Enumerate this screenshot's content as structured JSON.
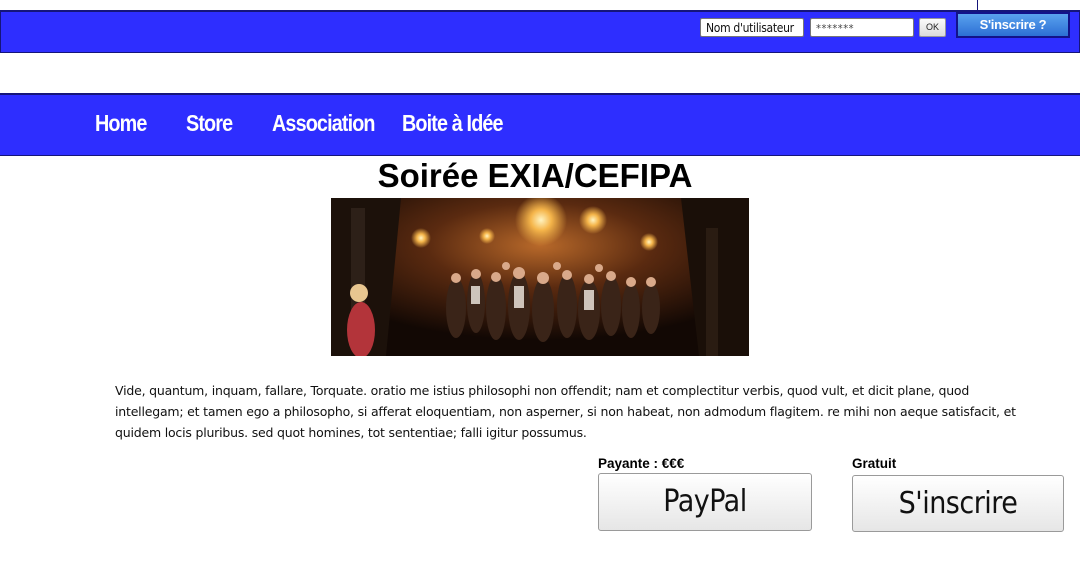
{
  "header": {
    "username_placeholder": "Nom d'utilisateur",
    "password_value": "*******",
    "ok_label": "OK",
    "signup_label": "S'inscrire ?"
  },
  "nav": {
    "items": [
      {
        "label": "Home"
      },
      {
        "label": "Store"
      },
      {
        "label": "Association"
      },
      {
        "label": "Boite à Idée"
      }
    ]
  },
  "event": {
    "title": "Soirée EXIA/CEFIPA",
    "description": "Vide, quantum, inquam, fallare, Torquate. oratio me istius philosophi non offendit; nam et complectitur verbis, quod vult, et dicit plane, quod intellegam; et tamen ego a philosopho, si afferat eloquentiam, non asperner, si non habeat, non admodum flagitem. re mihi non aeque satisfacit, et quidem locis pluribus. sed quot homines, tot sententiae; falli igitur possumus."
  },
  "payment": {
    "paid_label": "Payante : €€€",
    "paid_button": "PayPal",
    "free_label": "Gratuit",
    "free_button": "S'inscrire"
  }
}
